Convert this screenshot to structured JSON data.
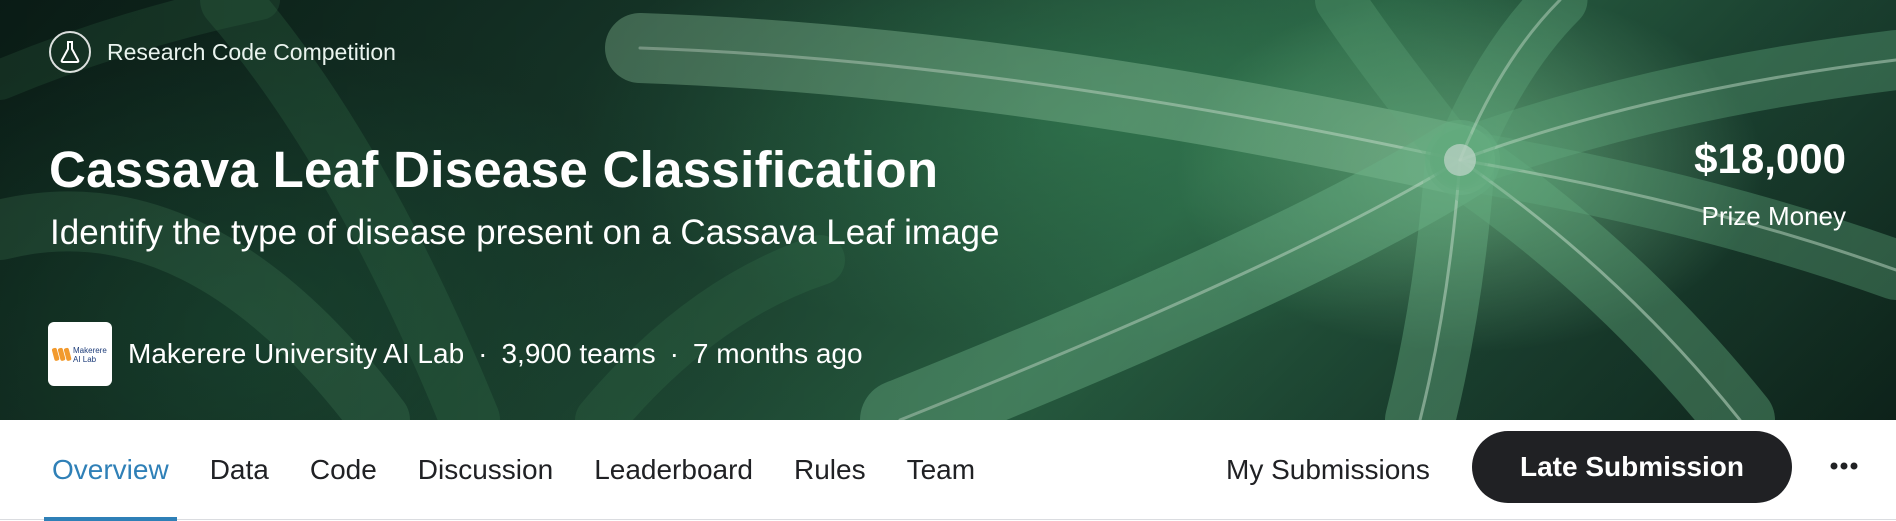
{
  "hero": {
    "competition_type": "Research Code Competition",
    "title": "Cassava Leaf Disease Classification",
    "subtitle": "Identify the type of disease present on a Cassava Leaf image",
    "organization": "Makerere University AI Lab",
    "logo_text": "Makerere AI Lab",
    "teams": "3,900 teams",
    "time_ago": "7 months ago",
    "separator": "·",
    "prize_amount": "$18,000",
    "prize_label": "Prize Money"
  },
  "nav": {
    "tabs": [
      {
        "label": "Overview",
        "active": true
      },
      {
        "label": "Data"
      },
      {
        "label": "Code"
      },
      {
        "label": "Discussion"
      },
      {
        "label": "Leaderboard"
      },
      {
        "label": "Rules"
      },
      {
        "label": "Team"
      }
    ],
    "my_submissions": "My Submissions",
    "late_submission": "Late Submission",
    "more_icon": "more-horizontal-icon"
  },
  "colors": {
    "active_tab": "#2f80b7",
    "button_bg": "#202124",
    "text_dark": "#202124"
  }
}
